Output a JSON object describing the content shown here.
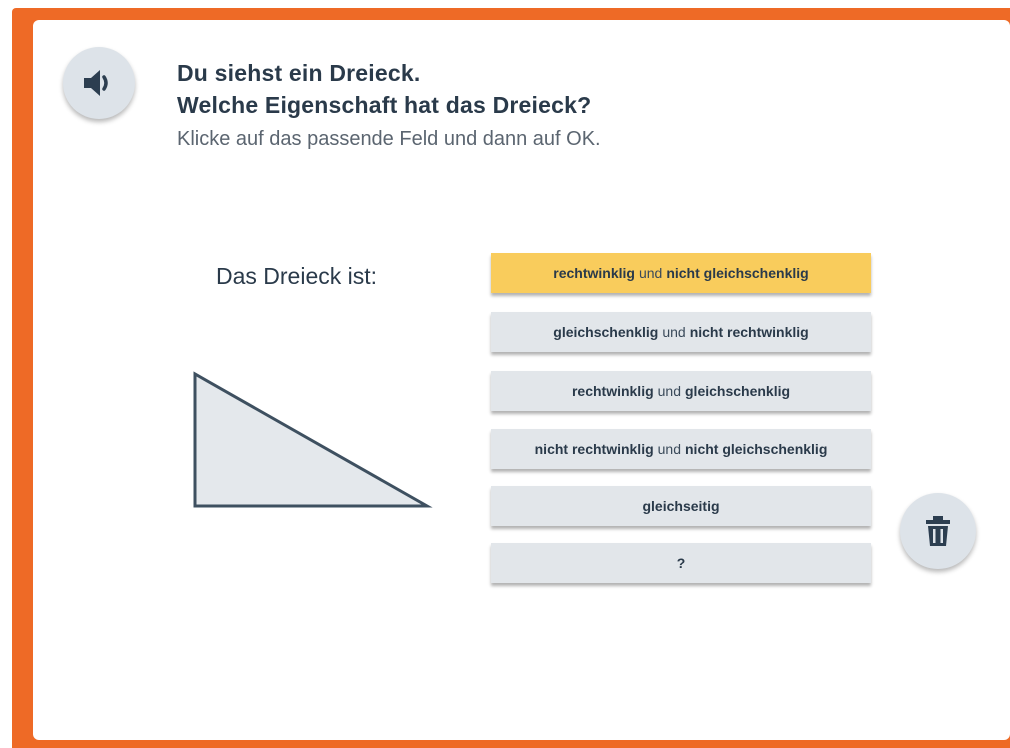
{
  "header": {
    "title_line1": "Du siehst ein Dreieck.",
    "title_line2": "Welche Eigenschaft hat das Dreieck?",
    "instruction": "Klicke auf das passende Feld und dann auf OK.",
    "speaker_icon": "speaker-icon"
  },
  "task": {
    "prompt": "Das Dreieck ist:"
  },
  "options": [
    {
      "part1": "rechtwinklig",
      "conn": "und",
      "part2": "nicht gleichschenklig",
      "selected": true
    },
    {
      "part1": "gleichschenklig",
      "conn": "und",
      "part2": "nicht rechtwinklig",
      "selected": false
    },
    {
      "part1": "rechtwinklig",
      "conn": "und",
      "part2": "gleichschenklig",
      "selected": false
    },
    {
      "part1": "nicht rechtwinklig",
      "conn": "und",
      "part2": "nicht gleichschenklig",
      "selected": false
    },
    {
      "part1": "gleichseitig",
      "conn": "",
      "part2": "",
      "selected": false
    },
    {
      "part1": "?",
      "conn": "",
      "part2": "",
      "selected": false
    }
  ],
  "trash_icon": "trash-icon",
  "colors": {
    "accent_orange": "#ee6a26",
    "selected_option": "#f9cc5c",
    "option_bg": "#e2e6ea",
    "triangle_fill": "#e4e8ec",
    "triangle_stroke": "#3e5060"
  }
}
